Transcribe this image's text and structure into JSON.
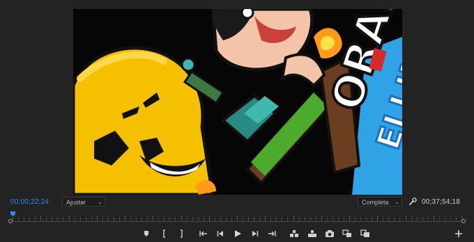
{
  "monitor": {
    "frame_content": "cartoon thumbnail artwork",
    "frame_text_1": "ORADE",
    "frame_text_2": "ELLIN"
  },
  "status": {
    "current_timecode": "00;00;22;24",
    "duration_timecode": "00;37;54;18",
    "fit_label": "Ajustar",
    "quality_label": "Completa"
  },
  "timeline": {
    "playhead_position_fraction": 0.003
  },
  "controls": [
    {
      "name": "add-marker-icon"
    },
    {
      "name": "mark-in-icon"
    },
    {
      "name": "mark-out-icon"
    },
    {
      "name": "go-to-in-icon"
    },
    {
      "name": "step-back-icon"
    },
    {
      "name": "play-icon"
    },
    {
      "name": "step-forward-icon"
    },
    {
      "name": "go-to-out-icon"
    },
    {
      "name": "insert-icon"
    },
    {
      "name": "overwrite-icon"
    },
    {
      "name": "export-frame-icon"
    },
    {
      "name": "compare-view-icon"
    },
    {
      "name": "toggle-proxies-icon"
    },
    {
      "name": "button-editor-icon"
    }
  ],
  "colors": {
    "accent": "#2d8ceb",
    "panel": "#232323"
  }
}
